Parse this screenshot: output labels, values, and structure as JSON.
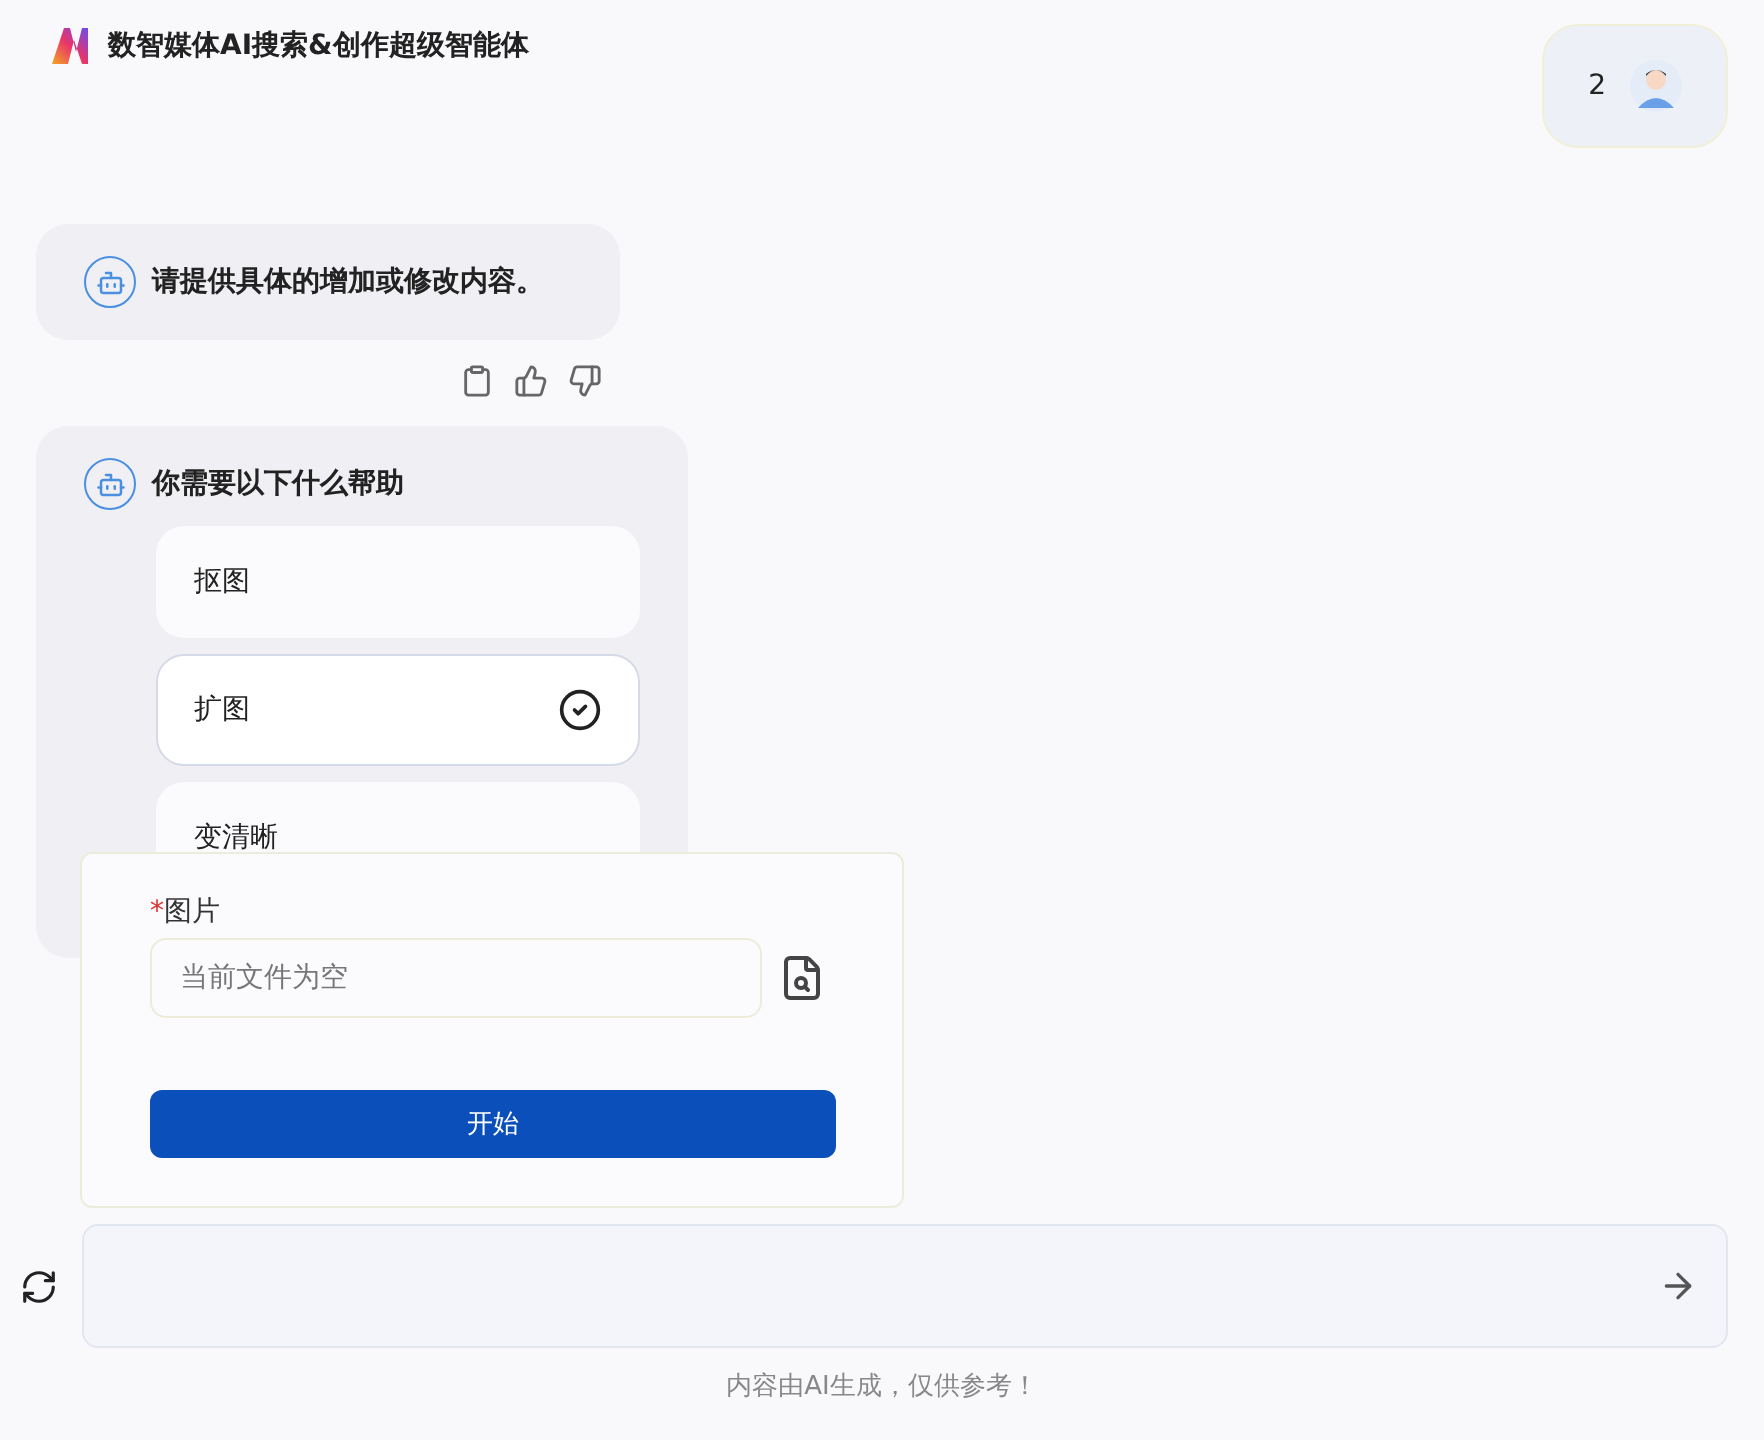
{
  "header": {
    "title": "数智媒体AI搜索&创作超级智能体",
    "user_count": "2"
  },
  "messages": [
    {
      "kind": "text",
      "text": "请提供具体的增加或修改内容。"
    },
    {
      "kind": "options",
      "text": "你需要以下什么帮助",
      "options": [
        {
          "label": "抠图",
          "selected": false
        },
        {
          "label": "扩图",
          "selected": true
        },
        {
          "label": "变清晰",
          "selected": false
        }
      ]
    }
  ],
  "form": {
    "field_label": "图片",
    "required": true,
    "required_mark": "*",
    "placeholder": "当前文件为空",
    "submit": "开始"
  },
  "footer_note": "内容由AI生成，仅供参考！"
}
